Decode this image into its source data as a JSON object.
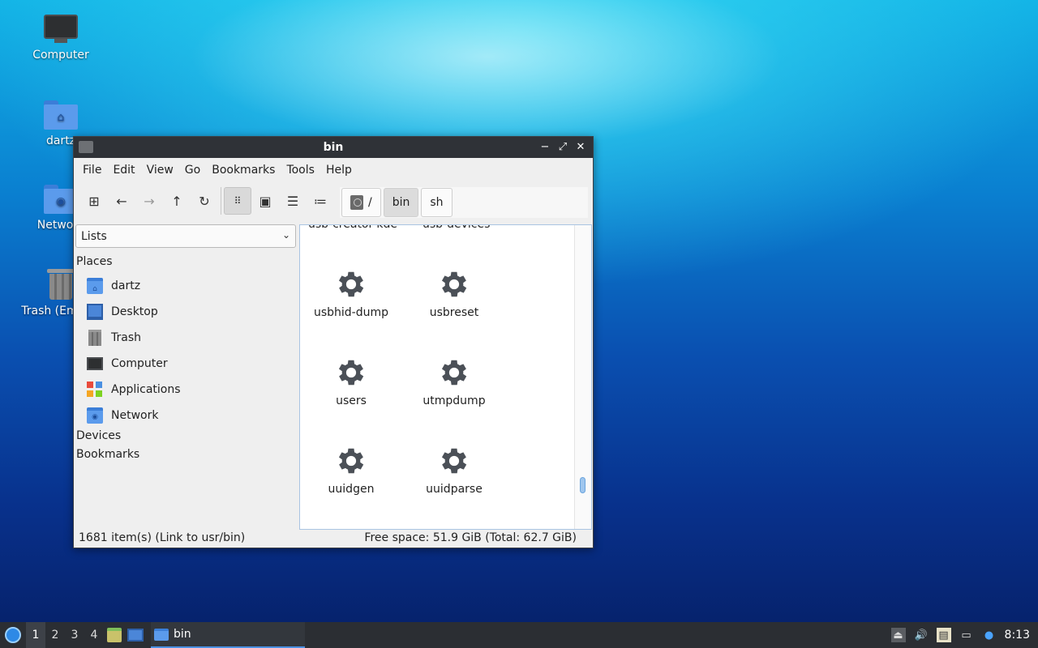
{
  "desktop": {
    "icons": [
      {
        "label": "Computer",
        "icon": "computer-icon"
      },
      {
        "label": "dartz",
        "icon": "home-folder-icon"
      },
      {
        "label": "Network",
        "icon": "network-folder-icon"
      },
      {
        "label": "Trash (Empty)",
        "icon": "trash-icon"
      }
    ]
  },
  "window": {
    "title": "bin",
    "menu": [
      "File",
      "Edit",
      "View",
      "Go",
      "Bookmarks",
      "Tools",
      "Help"
    ],
    "toolbar": {
      "buttons": [
        "new-tab-icon",
        "back-arrow-icon",
        "forward-arrow-icon",
        "up-arrow-icon",
        "reload-icon",
        "icon-view-icon",
        "thumbnail-view-icon",
        "compact-view-icon",
        "detailed-list-icon"
      ],
      "active_view": "icon-view"
    },
    "pathbar": {
      "root": "/",
      "crumbs": [
        "bin",
        "sh"
      ],
      "active": "bin"
    },
    "sidepanel": {
      "mode": "Lists",
      "places_header": "Places",
      "places": [
        {
          "label": "dartz",
          "icon": "home-folder-icon"
        },
        {
          "label": "Desktop",
          "icon": "desktop-icon"
        },
        {
          "label": "Trash",
          "icon": "trash-icon"
        },
        {
          "label": "Computer",
          "icon": "computer-icon"
        },
        {
          "label": "Applications",
          "icon": "applications-icon"
        },
        {
          "label": "Network",
          "icon": "network-folder-icon"
        }
      ],
      "devices_header": "Devices",
      "bookmarks_header": "Bookmarks"
    },
    "files": {
      "cut_off_top": [
        "usb-creator-kde",
        "usb-devices"
      ],
      "items": [
        "usbhid-dump",
        "usbreset",
        "users",
        "utmpdump",
        "uuidgen",
        "uuidparse"
      ]
    },
    "status": {
      "left": "1681 item(s) (Link to usr/bin)",
      "right": "Free space: 51.9 GiB (Total: 62.7 GiB)"
    }
  },
  "taskbar": {
    "workspaces": [
      "1",
      "2",
      "3",
      "4"
    ],
    "active_workspace": "1",
    "task_label": "bin",
    "clock": "8:13"
  }
}
